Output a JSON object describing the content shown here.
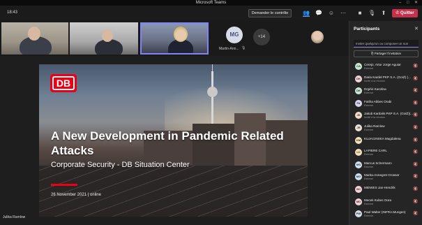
{
  "window": {
    "title": "Microsoft Teams"
  },
  "topbar": {
    "time": "18:43",
    "request_control": "Demander le contrôle",
    "quit": "Quitter"
  },
  "thumbnails": {
    "mg_initials": "MG",
    "mg_name": "Martin-Ann...",
    "more_count": "+14"
  },
  "slide": {
    "logo": "DB",
    "title": "A New Development in Pandemic Related Attacks",
    "subtitle": "Corporate Security - DB Situation Center",
    "date": "26 November 2021 | online"
  },
  "presenter": "Julika Ramlow",
  "panel": {
    "title": "Participants",
    "invite_placeholder": "Inviter quelqu'un ou composer un nun",
    "share_invite": "Partager l'invitation",
    "participants": [
      {
        "initials": "CA",
        "name": "Cerejo, Artur Jorge Aguiar",
        "sub": "Externe",
        "color": "#c9e6d6"
      },
      {
        "initials": "DK",
        "name": "Daria Kardel PKP S.A. (GoiŻ) (...",
        "sub": "Invité à la réunion",
        "color": "#f4d3d8"
      },
      {
        "initials": "DK",
        "name": "Drgińė Karolina",
        "sub": "Externe",
        "color": "#c9e6d6"
      },
      {
        "initials": "FA",
        "name": "Fatiha Abbes Orabi",
        "sub": "Externe",
        "color": "#d9d4f2"
      },
      {
        "initials": "JK",
        "name": "Jakub Kardalis PKP S.A. (GoiŻ)(...",
        "sub": "Invité à la réunion",
        "color": "#f2dcc8"
      },
      {
        "initials": "JR",
        "name": "Julika Ramlow",
        "sub": "Externe",
        "color": "#e8e2d8"
      },
      {
        "initials": "KM",
        "name": "KUJACINSKA Magdalena",
        "sub": "",
        "color": "#f4e3b8"
      },
      {
        "initials": "LC",
        "name": "LAPIERE CARL",
        "sub": "Externe",
        "color": "#f4e3b8"
      },
      {
        "initials": "MS",
        "name": "Marcus Schermann",
        "sub": "Externe",
        "color": "#cfe0f2"
      },
      {
        "initials": "MG",
        "name": "Marita-Annegret Grosser",
        "sub": "Externe",
        "color": "#cfe0f2"
      },
      {
        "initials": "MJ",
        "name": "MIEWES Jan-Hendrik",
        "sub": "",
        "color": "#f4d3d8"
      },
      {
        "initials": "MD",
        "name": "Mecek Kubec Dora",
        "sub": "Externe",
        "color": "#f4d3d8"
      },
      {
        "initials": "PW",
        "name": "Paul Walter (INFRA.Mungen)",
        "sub": "Externe",
        "color": "#d6dbe6"
      }
    ]
  }
}
